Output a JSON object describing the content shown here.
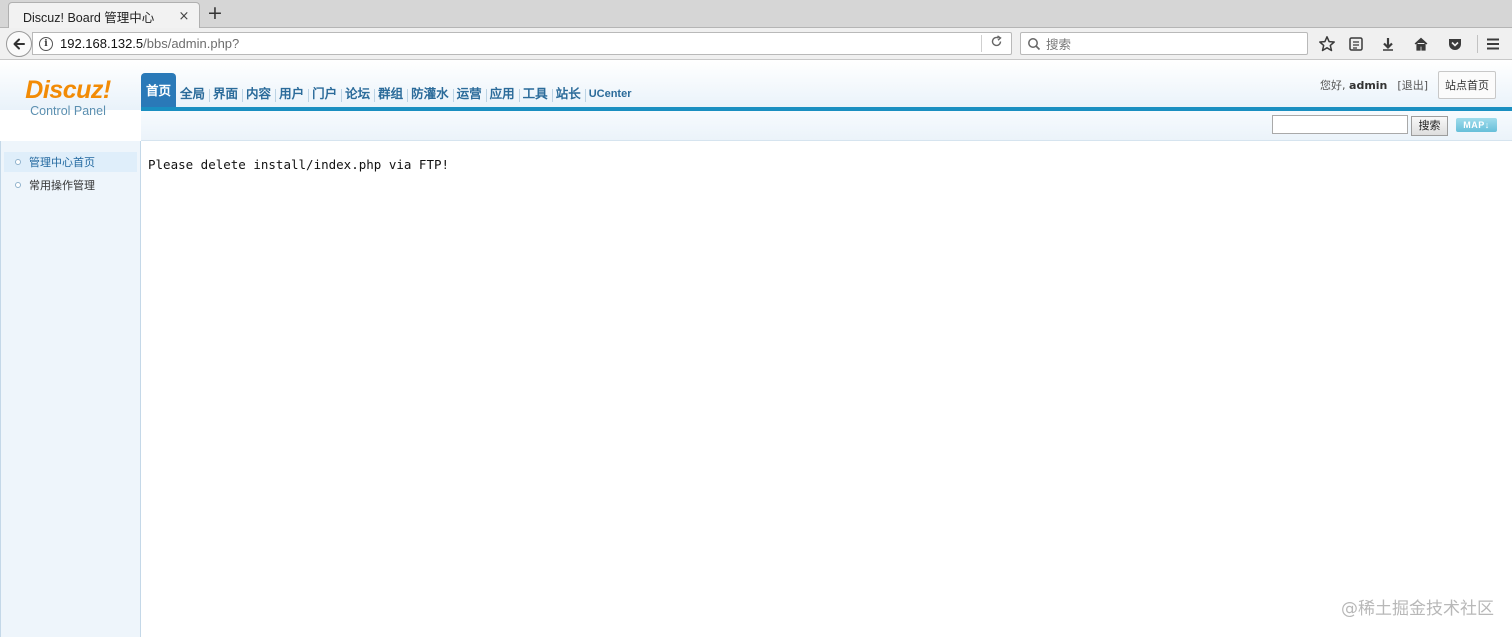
{
  "browser": {
    "tab_title": "Discuz! Board 管理中心",
    "tab_close": "×",
    "new_tab": "+",
    "url_host": "192.168.132.5",
    "url_path": "/bbs/admin.php?",
    "search_placeholder": "搜索"
  },
  "header": {
    "logo_main": "Discuz!",
    "logo_sub": "Control Panel",
    "nav": [
      {
        "label": "首页",
        "active": true
      },
      {
        "label": "全局"
      },
      {
        "label": "界面"
      },
      {
        "label": "内容"
      },
      {
        "label": "用户"
      },
      {
        "label": "门户"
      },
      {
        "label": "论坛"
      },
      {
        "label": "群组"
      },
      {
        "label": "防灌水"
      },
      {
        "label": "运营"
      },
      {
        "label": "应用"
      },
      {
        "label": "工具"
      },
      {
        "label": "站长"
      },
      {
        "label": "UCenter"
      }
    ],
    "greeting_prefix": "您好,",
    "username": "admin",
    "logout": "[退出]",
    "site_home": "站点首页"
  },
  "subbar": {
    "search_button": "搜索",
    "map_button": "MAP",
    "map_arrow": "↓"
  },
  "sidebar": {
    "items": [
      {
        "label": "管理中心首页",
        "active": true
      },
      {
        "label": "常用操作管理"
      }
    ]
  },
  "main": {
    "message": "Please delete install/index.php via FTP!"
  },
  "watermark": "@稀土掘金技术社区",
  "colors": {
    "brand_orange": "#f28b05",
    "nav_active": "#2a79b8",
    "accent_bar": "#1a8fc1",
    "nav_text": "#2b6b9a"
  }
}
